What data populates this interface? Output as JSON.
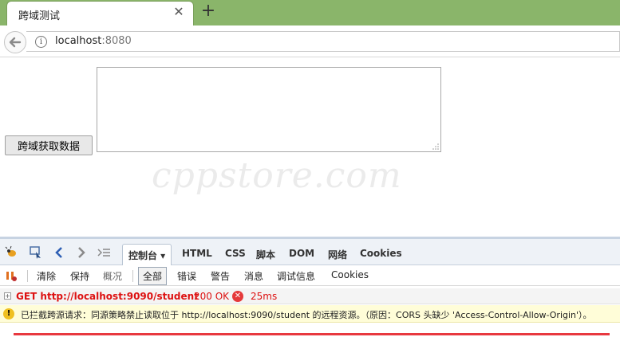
{
  "browser": {
    "tab_title": "跨域测试",
    "close_glyph": "✕",
    "new_tab_glyph": "+",
    "url_host": "localhost",
    "url_port": ":8080",
    "info_glyph": "i"
  },
  "page": {
    "fetch_button_label": "跨域获取数据",
    "result_value": "",
    "watermark": "cppstore.com"
  },
  "devtools": {
    "tabs": [
      "控制台 ▾",
      "HTML",
      "CSS",
      "脚本",
      "DOM",
      "网络",
      "Cookies"
    ],
    "sub_toolbar": [
      "清除",
      "保持",
      "概况",
      "全部",
      "错误",
      "警告",
      "消息",
      "调试信息",
      "Cookies"
    ],
    "log": {
      "expand_glyph": "+",
      "request": "GET http://localhost:9090/student",
      "status": "200 OK",
      "error_glyph": "✕",
      "time": "25ms"
    },
    "warning": {
      "glyph": "!",
      "message": "已拦截跨源请求：同源策略禁止读取位于 http://localhost:9090/student 的远程资源。（原因：CORS 头缺少 'Access-Control-Allow-Origin'）。"
    }
  },
  "colors": {
    "tabstrip": "#8ab56a",
    "error_red": "#dd1111",
    "warning_bg": "#fffdd8",
    "underline": "#e8383f"
  }
}
